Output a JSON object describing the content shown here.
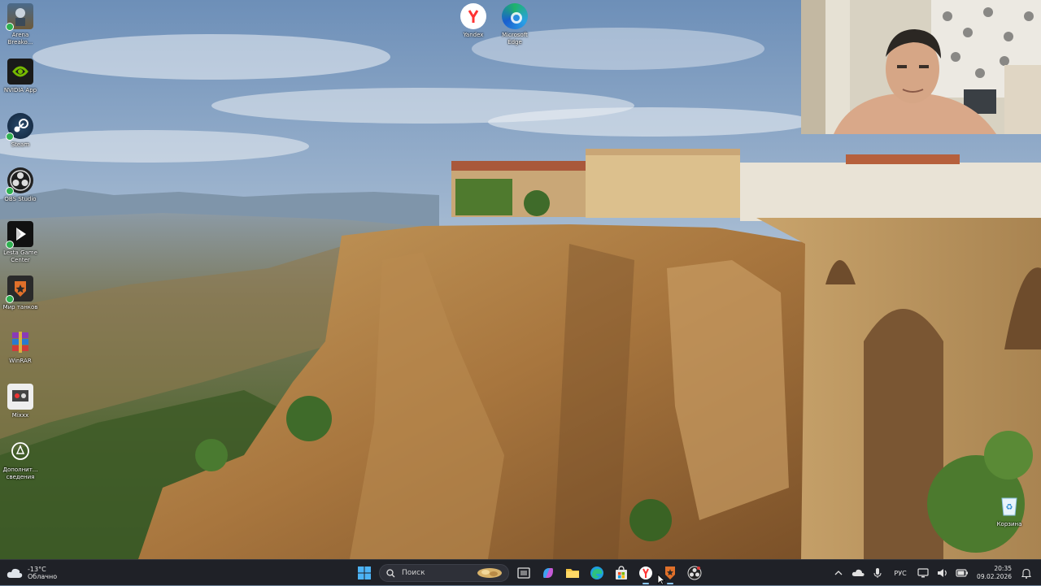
{
  "desktop_icons": [
    {
      "label": "Arena\nBreako...",
      "icon": "arena-breakout-icon"
    },
    {
      "label": "NVIDIA App",
      "icon": "nvidia-icon"
    },
    {
      "label": "Steam",
      "icon": "steam-icon"
    },
    {
      "label": "OBS Studio",
      "icon": "obs-icon"
    },
    {
      "label": "Lesta Game\nCenter",
      "icon": "lesta-icon"
    },
    {
      "label": "Мир танков",
      "icon": "mir-tankov-icon"
    },
    {
      "label": "WinRAR",
      "icon": "winrar-icon"
    },
    {
      "label": "Mixxx",
      "icon": "mixxx-icon"
    },
    {
      "label": "Дополнит...\nсведения",
      "icon": "info-icon"
    },
    {
      "label": "Yandex",
      "icon": "yandex-icon"
    },
    {
      "label": "Microsoft\nEdge",
      "icon": "edge-icon"
    },
    {
      "label": "Корзина",
      "icon": "recycle-bin-icon"
    }
  ],
  "taskbar": {
    "weather": {
      "temp": "-13°C",
      "condition": "Облачно"
    },
    "search_placeholder": "Поиск",
    "apps": [
      "start-icon",
      "task-view-icon",
      "copilot-icon",
      "file-explorer-icon",
      "edge-icon",
      "store-icon",
      "yandex-browser-icon",
      "mir-tankov-icon",
      "obs-icon"
    ],
    "tray": {
      "language": "РУС",
      "time": "20:35",
      "date": "09.02.2026"
    }
  },
  "colors": {
    "taskbar_bg": "#1f2127",
    "accent": "#8cc8ff"
  }
}
